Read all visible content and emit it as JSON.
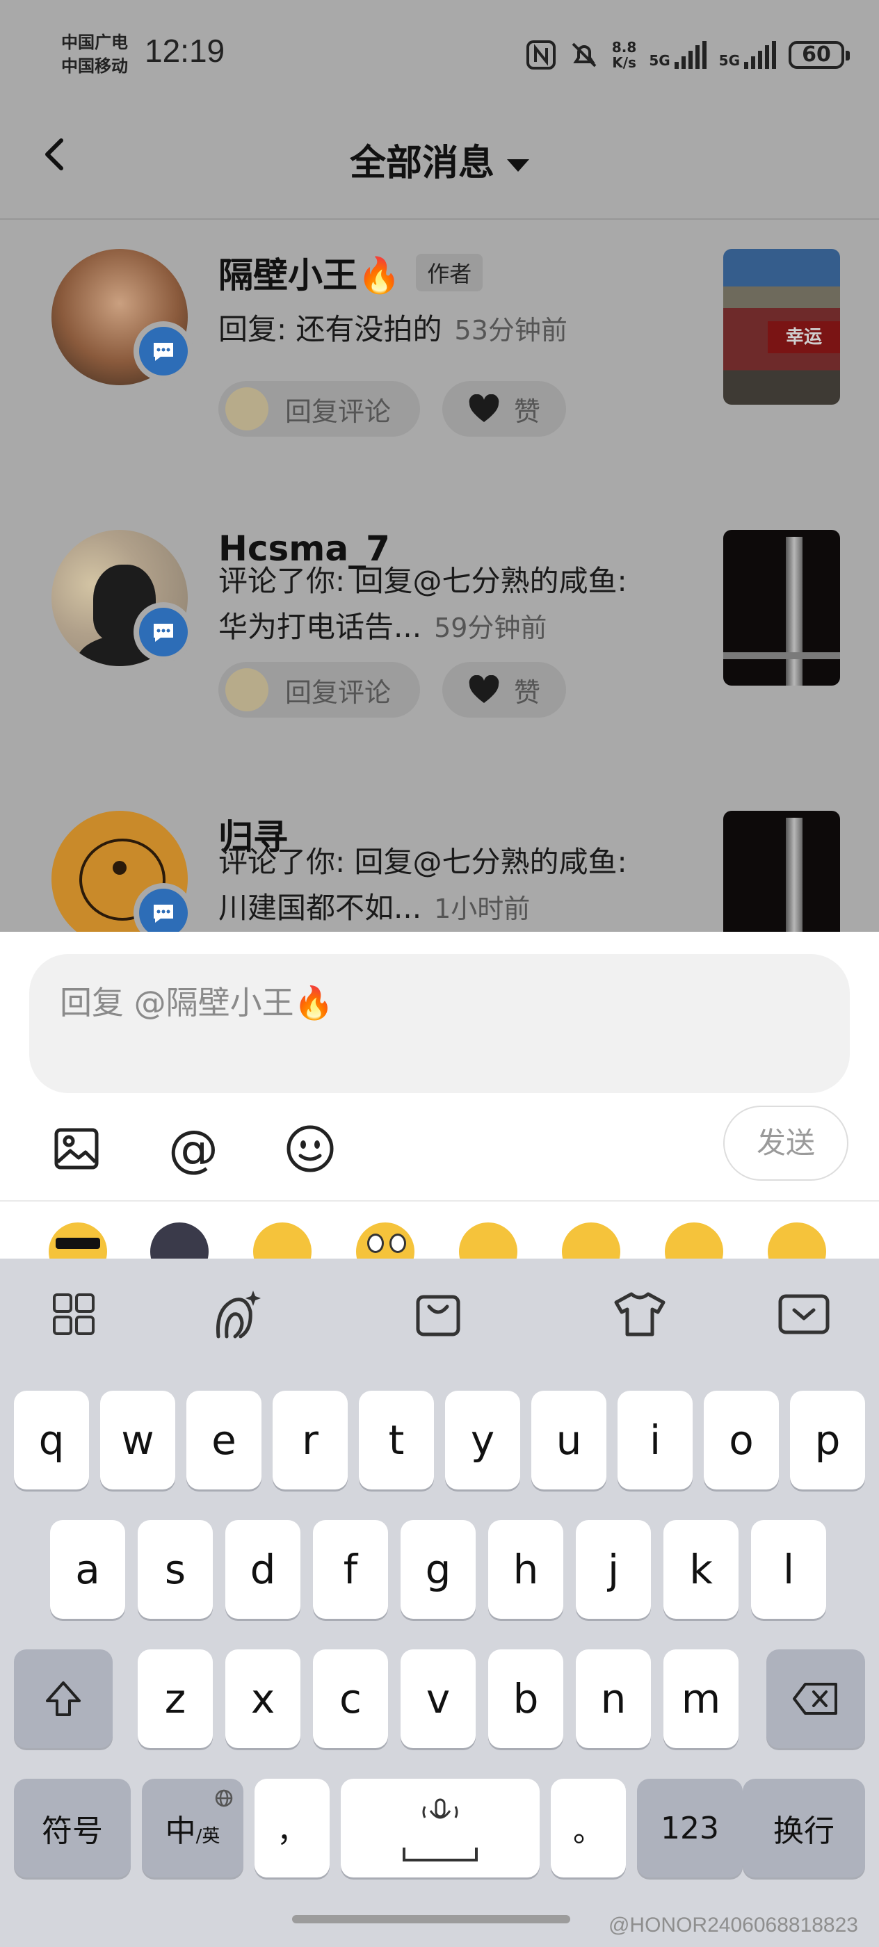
{
  "status_bar": {
    "carrier_1": "中国广电",
    "carrier_2": "中国移动",
    "time": "12:19",
    "speed_value": "8.8",
    "speed_unit": "K/s",
    "signal_1": "5G",
    "signal_2": "5G",
    "battery": "60"
  },
  "header": {
    "title": "全部消息"
  },
  "messages": [
    {
      "name": "隔壁小王🔥",
      "tag": "作者",
      "line1": "回复: 还有没拍的",
      "time": "53分钟前",
      "reply_label": "回复评论",
      "like_label": "赞"
    },
    {
      "name": "Hcsma_7",
      "line1": "评论了你: 回复@七分熟的咸鱼:",
      "line2": "华为打电话告...",
      "time": "59分钟前",
      "reply_label": "回复评论",
      "like_label": "赞"
    },
    {
      "name": "归寻",
      "line1": "评论了你: 回复@七分熟的咸鱼:",
      "line2": "川建国都不如...",
      "time": "1小时前"
    }
  ],
  "thumb_sign_text": "幸运",
  "reply_panel": {
    "placeholder": "回复 @隔壁小王🔥",
    "send_label": "发送",
    "at_label": "@"
  },
  "keyboard": {
    "row1": [
      "q",
      "w",
      "e",
      "r",
      "t",
      "y",
      "u",
      "i",
      "o",
      "p"
    ],
    "row2": [
      "a",
      "s",
      "d",
      "f",
      "g",
      "h",
      "j",
      "k",
      "l"
    ],
    "row3": [
      "z",
      "x",
      "c",
      "v",
      "b",
      "n",
      "m"
    ],
    "symbols_label": "符号",
    "lang_label": "中",
    "lang_sub": "/英",
    "comma": "，",
    "period": "。",
    "numbers_label": "123",
    "enter_label": "换行"
  },
  "watermark": "@HONOR2406068818823",
  "colors": {
    "dim_overlay": "#a9a9a9",
    "badge_blue": "#2d6db7",
    "keyboard_bg": "#d4d6dc"
  }
}
